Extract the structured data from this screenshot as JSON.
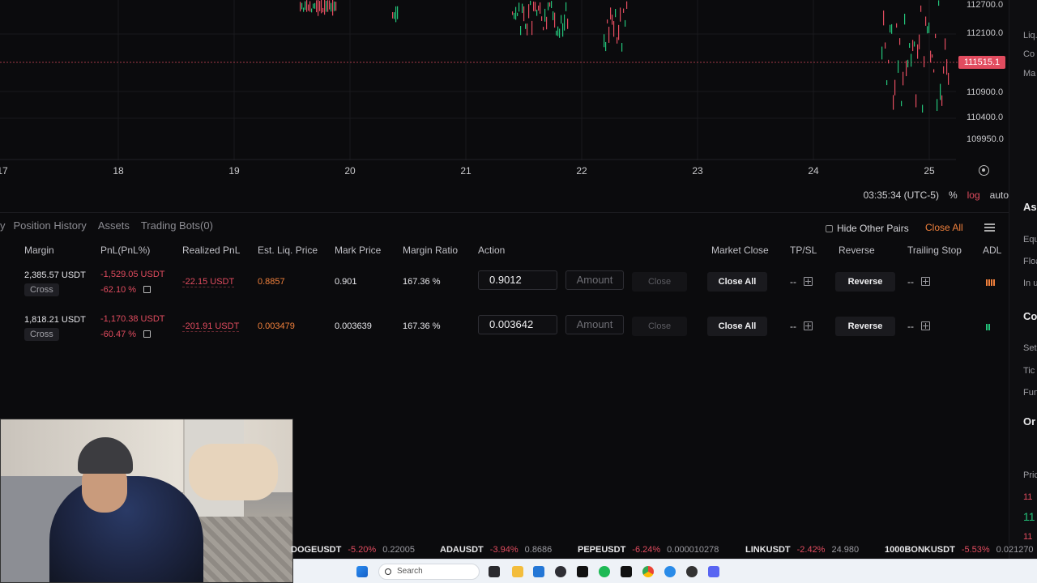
{
  "chart": {
    "price_levels": [
      "112700.0",
      "112100.0",
      "110900.0",
      "110400.0",
      "109950.0"
    ],
    "current_price": "111515.1",
    "dates": [
      "17",
      "18",
      "19",
      "20",
      "21",
      "22",
      "23",
      "24",
      "25"
    ]
  },
  "timebar": {
    "time": "03:35:34 (UTC-5)",
    "percent": "%",
    "log": "log",
    "auto": "auto"
  },
  "tabs": {
    "partial": "y",
    "position_history": "Position History",
    "assets": "Assets",
    "trading_bots": "Trading Bots(0)"
  },
  "controls": {
    "hide_other_pairs": "Hide Other Pairs",
    "close_all": "Close All"
  },
  "columns": {
    "margin": "Margin",
    "pnl": "PnL(PnL%)",
    "realized": "Realized PnL",
    "liq": "Est. Liq. Price",
    "mark": "Mark Price",
    "ratio": "Margin Ratio",
    "action": "Action",
    "market_close": "Market Close",
    "tpsl": "TP/SL",
    "reverse": "Reverse",
    "trailing": "Trailing Stop",
    "adl": "ADL"
  },
  "rows": [
    {
      "margin": "2,385.57 USDT",
      "mode": "Cross",
      "pnl": "-1,529.05 USDT",
      "pnl_pct": "-62.10 %",
      "realized": "-22.15 USDT",
      "liq": "0.8857",
      "mark": "0.901",
      "ratio": "167.36 %",
      "price_input": "0.9012",
      "amount_placeholder": "Amount",
      "close": "Close",
      "close_all": "Close All",
      "tpsl": "--",
      "reverse": "Reverse",
      "trailing": "--"
    },
    {
      "margin": "1,818.21 USDT",
      "mode": "Cross",
      "pnl": "-1,170.38 USDT",
      "pnl_pct": "-60.47 %",
      "realized": "-201.91 USDT",
      "liq": "0.003479",
      "mark": "0.003639",
      "ratio": "167.36 %",
      "price_input": "0.003642",
      "amount_placeholder": "Amount",
      "close": "Close",
      "close_all": "Close All",
      "tpsl": "--",
      "reverse": "Reverse",
      "trailing": "--"
    }
  ],
  "right_panel": {
    "liq": "Liq.",
    "co": "Co",
    "ma": "Ma",
    "as": "As",
    "equ": "Equ",
    "floa": "Floa",
    "inu": "In u",
    "co2": "Co",
    "set": "Set",
    "tic": "Tic",
    "fun": "Fun",
    "or": "Or",
    "pric": "Pric",
    "p1": "11",
    "p2": "11",
    "p3": "11"
  },
  "ticker": [
    {
      "sym": "DOGEUSDT",
      "chg": "-5.20%",
      "px": "0.22005"
    },
    {
      "sym": "ADAUSDT",
      "chg": "-3.94%",
      "px": "0.8686"
    },
    {
      "sym": "PEPEUSDT",
      "chg": "-6.24%",
      "px": "0.000010278"
    },
    {
      "sym": "LINKUSDT",
      "chg": "-2.42%",
      "px": "24.980"
    },
    {
      "sym": "1000BONKUSDT",
      "chg": "-5.53%",
      "px": "0.021270"
    }
  ],
  "taskbar": {
    "search": "Search"
  },
  "colors": {
    "up": "#23c37a",
    "down": "#e24c5f",
    "accent": "#f0803c"
  }
}
